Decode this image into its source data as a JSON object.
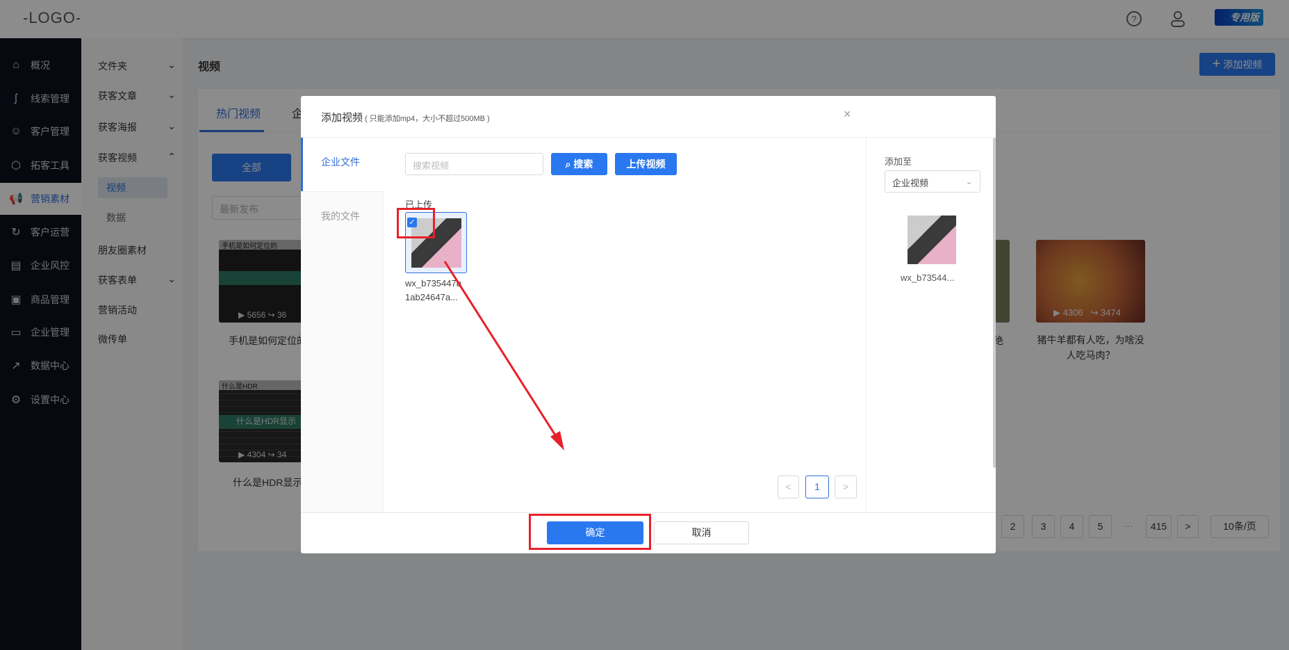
{
  "header": {
    "logo": "-LOGO-",
    "badge": "专用版",
    "help_icon": "question-circle-icon",
    "user_icon": "user-icon"
  },
  "sidebar": {
    "items": [
      {
        "label": "概况",
        "icon": "⌂"
      },
      {
        "label": "线索管理",
        "icon": "∫"
      },
      {
        "label": "客户管理",
        "icon": "☺"
      },
      {
        "label": "拓客工具",
        "icon": "⬡"
      },
      {
        "label": "营销素材",
        "icon": "📢"
      },
      {
        "label": "客户运营",
        "icon": "↻"
      },
      {
        "label": "企业风控",
        "icon": "▤"
      },
      {
        "label": "商品管理",
        "icon": "▣"
      },
      {
        "label": "企业管理",
        "icon": "▭"
      },
      {
        "label": "数据中心",
        "icon": "↗"
      },
      {
        "label": "设置中心",
        "icon": "⚙"
      }
    ]
  },
  "submenu": {
    "folder": "文件夹",
    "article": "获客文章",
    "poster": "获客海报",
    "video": "获客视频",
    "video_sub": "视频",
    "data_sub": "数据",
    "moments": "朋友圈素材",
    "form": "获客表单",
    "activity": "营销活动",
    "flyer": "微传单"
  },
  "page": {
    "title": "视频",
    "add_button": "添加视频",
    "tabs": [
      "热门视频",
      "企"
    ],
    "filter_all": "全部",
    "sort_placeholder": "最新发布",
    "videos": [
      {
        "title": "手机是如何定位的",
        "thumb_text": "手机是如何定位的",
        "plays": "5656",
        "shares": "36"
      },
      {
        "title": "什么是HDR显示",
        "thumb_text": "什么是HDR显示",
        "plays": "4304",
        "shares": "34"
      },
      {
        "title": "猪牛羊都有人吃，为啥没人吃马肉？",
        "plays": "4306",
        "shares": "3474"
      }
    ],
    "partial_text": "绝",
    "pagination": {
      "pages": [
        "2",
        "3",
        "4",
        "5"
      ],
      "ellipsis": "···",
      "last": "415",
      "next": ">",
      "page_size": "10条/页"
    }
  },
  "modal": {
    "title": "添加视频",
    "subtitle": "( 只能添加mp4，大小不超过500MB )",
    "close": "×",
    "tabs": [
      "企业文件",
      "我的文件"
    ],
    "search_placeholder": "搜索视频",
    "search_button": "搜索",
    "upload_button": "上传视频",
    "section": "已上传",
    "file": {
      "name_line1": "wx_b735447b",
      "name_line2": "1ab24647a...",
      "checked": true
    },
    "pagination": {
      "prev": "<",
      "current": "1",
      "next": ">"
    },
    "add_to_label": "添加至",
    "add_to_value": "企业视频",
    "selected_name": "wx_b73544...",
    "confirm": "确定",
    "cancel": "取消"
  }
}
